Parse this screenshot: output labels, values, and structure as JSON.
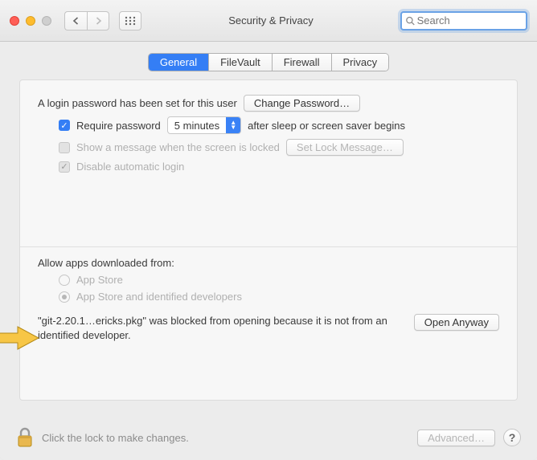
{
  "window": {
    "title": "Security & Privacy"
  },
  "search": {
    "placeholder": "Search"
  },
  "tabs": [
    "General",
    "FileVault",
    "Firewall",
    "Privacy"
  ],
  "login": {
    "label": "A login password has been set for this user",
    "change_btn": "Change Password…"
  },
  "require_pw": {
    "label_before": "Require password",
    "delay": "5 minutes",
    "label_after": "after sleep or screen saver begins"
  },
  "show_msg": {
    "label": "Show a message when the screen is locked",
    "btn": "Set Lock Message…"
  },
  "disable_auto": {
    "label": "Disable automatic login"
  },
  "allow": {
    "heading": "Allow apps downloaded from:",
    "opt1": "App Store",
    "opt2": "App Store and identified developers"
  },
  "blocked": {
    "text": "\"git-2.20.1…ericks.pkg\" was blocked from opening because it is not from an identified developer.",
    "btn": "Open Anyway"
  },
  "footer": {
    "lock_hint": "Click the lock to make changes.",
    "advanced": "Advanced…"
  }
}
